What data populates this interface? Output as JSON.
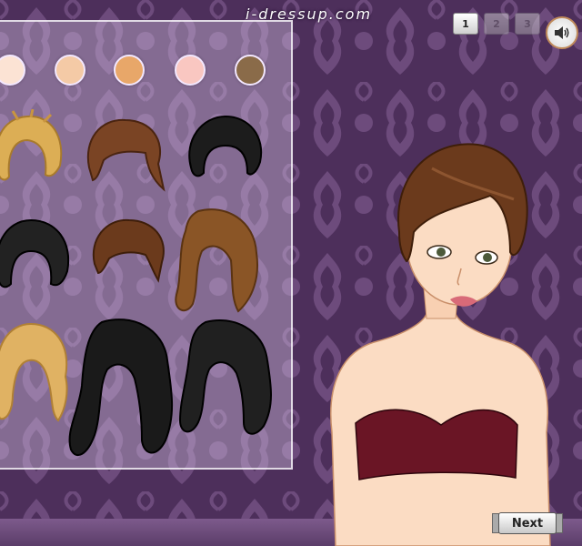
{
  "site": {
    "watermark": "i-dressup.com"
  },
  "pagination": {
    "pages": [
      "1",
      "2",
      "3"
    ],
    "active_page": "1"
  },
  "sound": {
    "icon": "speaker-icon"
  },
  "skin_tones": [
    "#fce3d4",
    "#f4caa6",
    "#e8a769",
    "#f9c7c1",
    "#8a6b49"
  ],
  "hairstyles": [
    {
      "name": "blonde-messy",
      "color": "#dcae55"
    },
    {
      "name": "brown-spiky",
      "color": "#7a4424"
    },
    {
      "name": "black-short",
      "color": "#1c1c1c"
    },
    {
      "name": "black-bob",
      "color": "#222222"
    },
    {
      "name": "brown-updo",
      "color": "#6b3a1c"
    },
    {
      "name": "brown-wavy",
      "color": "#8a5526"
    },
    {
      "name": "blonde-curly",
      "color": "#e0b263"
    },
    {
      "name": "black-long-curly",
      "color": "#1a1a1a"
    },
    {
      "name": "black-long-wavy",
      "color": "#202020"
    }
  ],
  "model": {
    "hair_color": "#6b3a1c",
    "skin_color": "#fbdcc3",
    "top_color": "#6a1525"
  },
  "buttons": {
    "next_label": "Next"
  }
}
